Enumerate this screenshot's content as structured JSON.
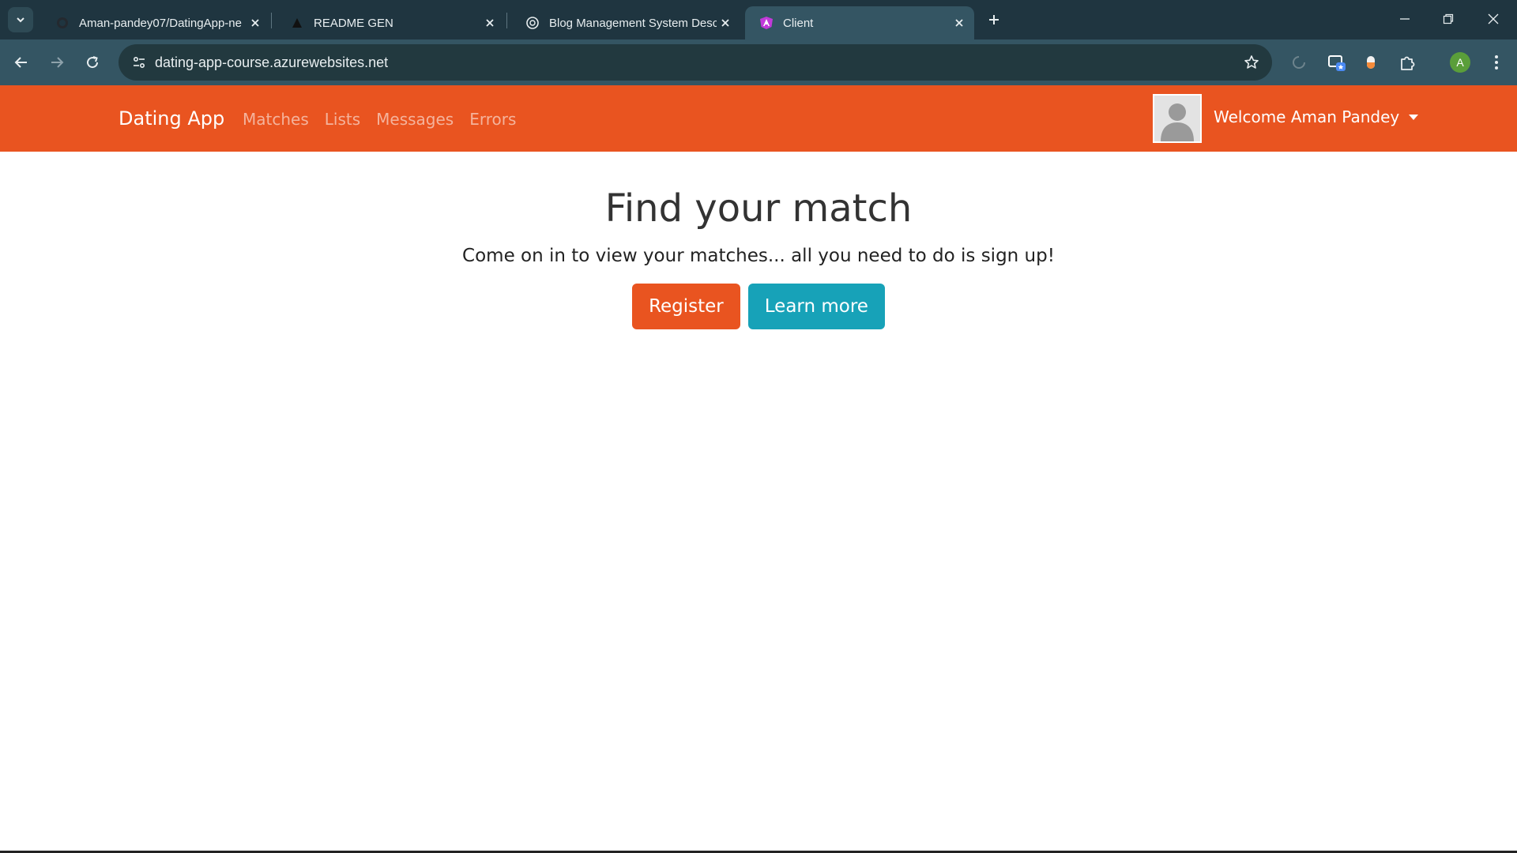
{
  "browser": {
    "tabs": [
      {
        "title": "Aman-pandey07/DatingApp-ne",
        "icon": "github-icon"
      },
      {
        "title": "README GEN",
        "icon": "readme-gen-icon"
      },
      {
        "title": "Blog Management System Desc",
        "icon": "chatgpt-icon"
      },
      {
        "title": "Client",
        "icon": "angular-icon",
        "active": true
      }
    ],
    "url": "dating-app-course.azurewebsites.net",
    "profile_initial": "A"
  },
  "navbar": {
    "brand": "Dating App",
    "links": [
      "Matches",
      "Lists",
      "Messages",
      "Errors"
    ],
    "welcome": "Welcome Aman Pandey",
    "color": "#e95420"
  },
  "hero": {
    "title": "Find your match",
    "subtitle": "Come on in to view your matches... all you need to do is sign up!",
    "register_label": "Register",
    "learn_more_label": "Learn more"
  },
  "colors": {
    "primary": "#e95420",
    "info": "#17a2b8",
    "chrome_dark": "#1f3540",
    "chrome_toolbar": "#345563"
  }
}
